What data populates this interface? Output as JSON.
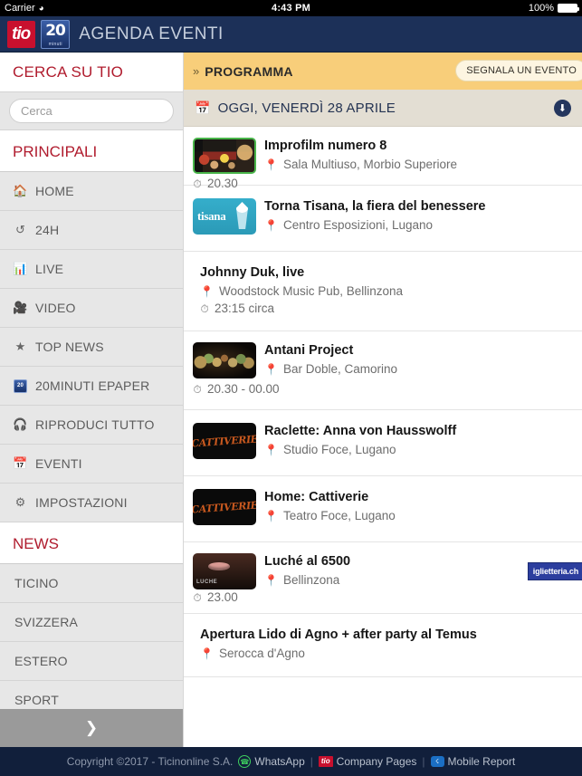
{
  "status_bar": {
    "carrier": "Carrier",
    "wifi_icon": "wifi-icon",
    "time": "4:43 PM",
    "battery_pct": "100%"
  },
  "app_header": {
    "logo_tio": "tio",
    "logo_20": "20",
    "logo_20_sub": "minuti",
    "title": "AGENDA EVENTI",
    "bg_color": "#1c3058"
  },
  "sidebar": {
    "search_title": "CERCA SU TIO",
    "search_placeholder": "Cerca",
    "search_value": "",
    "search_icon": "search-icon",
    "search_button_color": "#3aa35e",
    "sections": [
      {
        "title": "PRINCIPALI",
        "items": [
          {
            "label": "HOME",
            "icon": "home-icon",
            "glyph": "⌂"
          },
          {
            "label": "24H",
            "icon": "history-icon",
            "glyph": "↺"
          },
          {
            "label": "LIVE",
            "icon": "bar-chart-icon",
            "glyph": "▐"
          },
          {
            "label": "VIDEO",
            "icon": "video-camera-icon",
            "glyph": "▶"
          },
          {
            "label": "TOP NEWS",
            "icon": "star-icon",
            "glyph": "★"
          },
          {
            "label": "20MINUTI EPAPER",
            "icon": "epaper-icon",
            "glyph": "20"
          },
          {
            "label": "RIPRODUCI TUTTO",
            "icon": "headphones-icon",
            "glyph": "Ω"
          },
          {
            "label": "EVENTI",
            "icon": "calendar-icon",
            "glyph": "▦"
          },
          {
            "label": "IMPOSTAZIONI",
            "icon": "gear-icon",
            "glyph": "⚙"
          }
        ]
      },
      {
        "title": "NEWS",
        "items": [
          {
            "label": "TICINO",
            "icon": "",
            "glyph": ""
          },
          {
            "label": "SVIZZERA",
            "icon": "",
            "glyph": ""
          },
          {
            "label": "ESTERO",
            "icon": "",
            "glyph": ""
          },
          {
            "label": "SPORT",
            "icon": "",
            "glyph": ""
          }
        ]
      }
    ],
    "expand_more_icon": "chevron-down-icon",
    "accent_color": "#b01c2e"
  },
  "main": {
    "program_bar": {
      "chevron": "»",
      "title": "PROGRAMMA",
      "report_button": "SEGNALA UN EVENTO",
      "bg_color": "#f8ce7a"
    },
    "date_bar": {
      "calendar_icon": "calendar-icon",
      "label": "OGGI, VENERDÌ 28 APRILE",
      "download_icon": "download-circle-icon",
      "bg_color": "#e3ded3"
    },
    "events": [
      {
        "title": "Improfilm numero 8",
        "venue": "Sala Multiuso, Morbio Superiore",
        "time": "20.30",
        "thumb": "improfilm",
        "has_thumb": true,
        "ticket_badge": ""
      },
      {
        "title": "Torna Tisana, la fiera del benessere",
        "venue": "Centro Esposizioni, Lugano",
        "time": "",
        "thumb": "tisana",
        "has_thumb": true,
        "ticket_badge": ""
      },
      {
        "title": "Johnny Duk, live",
        "venue": "Woodstock Music Pub, Bellinzona",
        "time": "23:15 circa",
        "thumb": "",
        "has_thumb": false,
        "ticket_badge": ""
      },
      {
        "title": "Antani Project",
        "venue": "Bar Doble, Camorino",
        "time": "20.30 - 00.00",
        "thumb": "antani",
        "has_thumb": true,
        "ticket_badge": ""
      },
      {
        "title": "Raclette: Anna von Hausswolff",
        "venue": "Studio Foce, Lugano",
        "time": "",
        "thumb": "cattiverie",
        "has_thumb": true,
        "ticket_badge": ""
      },
      {
        "title": "Home: Cattiverie",
        "venue": "Teatro Foce, Lugano",
        "time": "",
        "thumb": "cattiverie",
        "has_thumb": true,
        "ticket_badge": ""
      },
      {
        "title": "Luché al 6500",
        "venue": "Bellinzona",
        "time": "23.00",
        "thumb": "luche",
        "has_thumb": true,
        "ticket_badge": "iglietteria.ch"
      },
      {
        "title": "Apertura Lido di Agno + after party al Temus",
        "venue": "Serocca d'Agno",
        "time": "",
        "thumb": "",
        "has_thumb": false,
        "ticket_badge": ""
      }
    ],
    "location_glyph": "●",
    "clock_glyph": "◔"
  },
  "footer": {
    "copyright": "Copyright ©2017 - Ticinonline S.A.",
    "whatsapp_label": "WhatsApp",
    "whatsapp_icon": "whatsapp-icon",
    "separator": "|",
    "company_pages_label": "Company Pages",
    "company_pages_icon": "tio-icon",
    "mobile_report_label": "Mobile Report",
    "mobile_report_icon": "chat-icon",
    "bg_color": "#111f3b"
  }
}
